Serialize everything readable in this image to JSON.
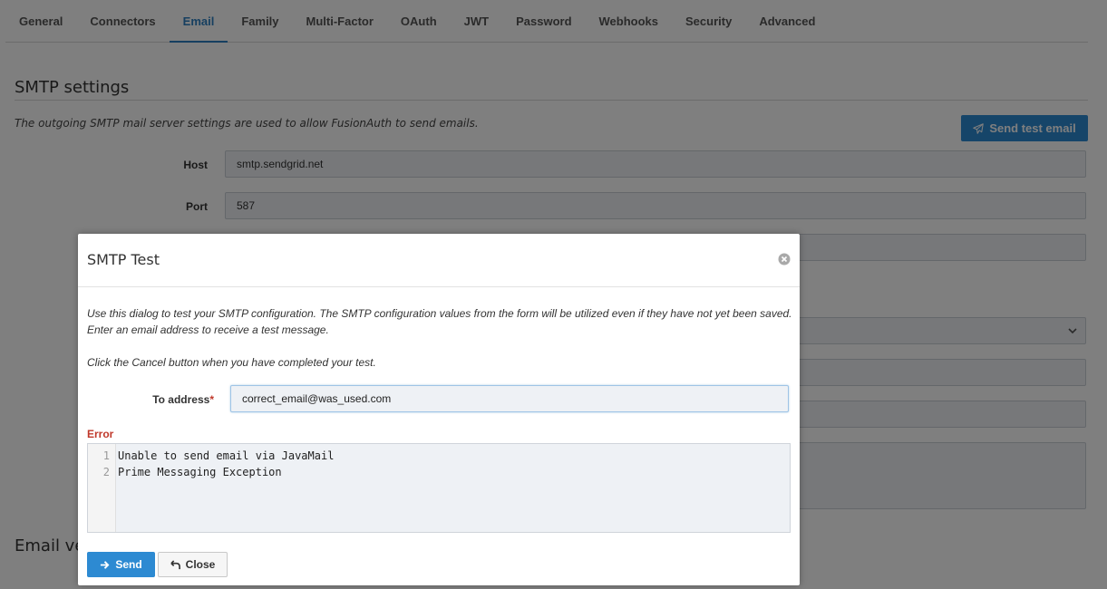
{
  "tabs": [
    {
      "label": "General"
    },
    {
      "label": "Connectors"
    },
    {
      "label": "Email",
      "active": true
    },
    {
      "label": "Family"
    },
    {
      "label": "Multi-Factor"
    },
    {
      "label": "OAuth"
    },
    {
      "label": "JWT"
    },
    {
      "label": "Password"
    },
    {
      "label": "Webhooks"
    },
    {
      "label": "Security"
    },
    {
      "label": "Advanced"
    }
  ],
  "smtp": {
    "section_title": "SMTP settings",
    "description": "The outgoing SMTP mail server settings are used to allow FusionAuth to send emails.",
    "send_test_label": "Send test email",
    "host_label": "Host",
    "host_value": "smtp.sendgrid.net",
    "port_label": "Port",
    "port_value": "587"
  },
  "email_verification": {
    "section_title_partial": "Email ve"
  },
  "dialog": {
    "title": "SMTP Test",
    "instructions_line1": "Use this dialog to test your SMTP configuration. The SMTP configuration values from the form will be utilized even if they have not yet been saved.",
    "instructions_line2": "Enter an email address to receive a test message.",
    "cancel_hint": "Click the Cancel button when you have completed your test.",
    "to_label": "To address",
    "required_mark": "*",
    "to_value": "correct_email@was_used.com",
    "error_label": "Error",
    "error_lines": [
      {
        "num": "1",
        "text": "Unable to send email via JavaMail"
      },
      {
        "num": "2",
        "text": "Prime Messaging Exception"
      }
    ],
    "send_label": "Send",
    "close_label": "Close"
  },
  "colors": {
    "accent": "#2d8ad2",
    "error": "#c0392b"
  },
  "icons": {
    "send_test": "paper-plane-icon",
    "dialog_close": "circle-x-icon",
    "send": "arrow-right-icon",
    "close": "undo-arrow-icon",
    "select": "chevron-down-icon"
  }
}
